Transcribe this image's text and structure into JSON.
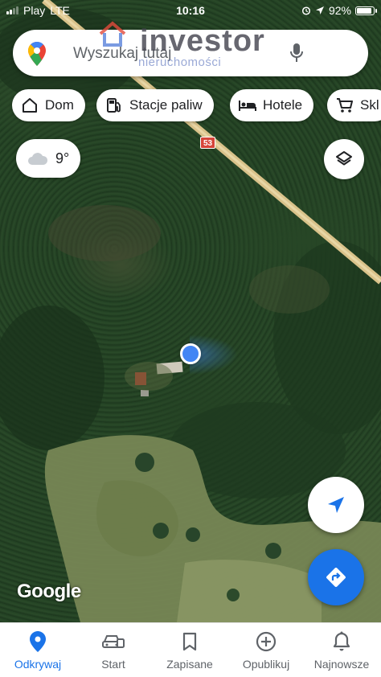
{
  "status_bar": {
    "carrier": "Play",
    "network": "LTE",
    "time": "10:16",
    "battery": "92%",
    "battery_level": 0.92
  },
  "search": {
    "placeholder": "Wyszukaj tutaj"
  },
  "watermark": {
    "brand": "investor",
    "subtitle": "nieruchomości"
  },
  "chips": [
    {
      "label": "Dom",
      "icon": "home-icon"
    },
    {
      "label": "Stacje paliw",
      "icon": "gas-station-icon"
    },
    {
      "label": "Hotele",
      "icon": "hotel-bed-icon"
    },
    {
      "label": "Skl",
      "icon": "shopping-cart-icon"
    }
  ],
  "weather": {
    "temperature": "9°",
    "icon": "cloud-icon"
  },
  "map": {
    "road_number": "53",
    "attribution": "Google"
  },
  "bottom_nav": [
    {
      "label": "Odkrywaj",
      "icon": "location-pin-icon",
      "active": true
    },
    {
      "label": "Start",
      "icon": "car-icon",
      "active": false
    },
    {
      "label": "Zapisane",
      "icon": "bookmark-icon",
      "active": false
    },
    {
      "label": "Opublikuj",
      "icon": "add-circle-icon",
      "active": false
    },
    {
      "label": "Najnowsze",
      "icon": "bell-icon",
      "active": false
    }
  ],
  "colors": {
    "accent": "#1a73e8",
    "location_dot": "#4285f4",
    "road": "#d9c28a",
    "road_shield": "#d6453a"
  }
}
